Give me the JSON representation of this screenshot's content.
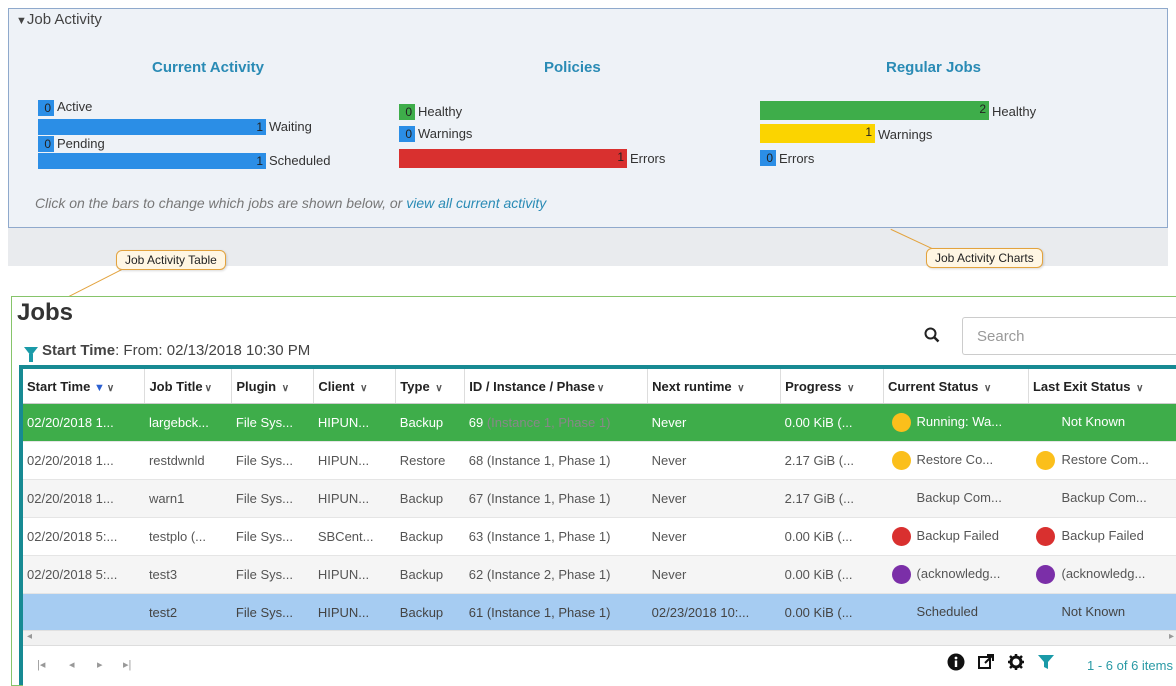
{
  "activity": {
    "header": "Job Activity",
    "sections": {
      "current": {
        "title": "Current Activity",
        "bars": [
          {
            "value": "0",
            "label": "Active"
          },
          {
            "value": "1",
            "label": "Waiting"
          },
          {
            "value": "0",
            "label": "Pending"
          },
          {
            "value": "1",
            "label": "Scheduled"
          }
        ]
      },
      "policies": {
        "title": "Policies",
        "bars": [
          {
            "value": "0",
            "label": "Healthy"
          },
          {
            "value": "0",
            "label": "Warnings"
          },
          {
            "value": "1",
            "label": "Errors"
          }
        ]
      },
      "regular": {
        "title": "Regular Jobs",
        "bars": [
          {
            "value": "2",
            "label": "Healthy"
          },
          {
            "value": "1",
            "label": "Warnings"
          },
          {
            "value": "0",
            "label": "Errors"
          }
        ]
      }
    },
    "hint_prefix": "Click on the bars to change which jobs are shown below, or ",
    "hint_link": "view all current activity"
  },
  "callouts": {
    "table": "Job Activity Table",
    "charts": "Job Activity Charts"
  },
  "jobs": {
    "title": "Jobs",
    "filter_label": "Start Time",
    "filter_value": ": From: 02/13/2018 10:30 PM",
    "search_placeholder": "Search",
    "columns": [
      "Start Time",
      "Job Title",
      "Plugin",
      "Client",
      "Type",
      "ID / Instance / Phase",
      "Next runtime",
      "Progress",
      "Current Status",
      "Last Exit Status"
    ],
    "rows": [
      {
        "start": "02/20/2018 1...",
        "title": "largebck...",
        "plugin": "File Sys...",
        "client": "HIPUN...",
        "type": "Backup",
        "id": "69",
        "instance": "(Instance 1, Phase 1)",
        "next": "Never",
        "progress": "0.00 KiB (...",
        "current": "Running: Wa...",
        "current_color": "#fbbf1b",
        "last": "Not Known",
        "last_color": ""
      },
      {
        "start": "02/20/2018 1...",
        "title": "restdwnld",
        "plugin": "File Sys...",
        "client": "HIPUN...",
        "type": "Restore",
        "id": "68",
        "instance": "(Instance 1, Phase 1)",
        "next": "Never",
        "progress": "2.17 GiB (...",
        "current": "Restore Co...",
        "current_color": "#fbbf1b",
        "last": "Restore Com...",
        "last_color": "#fbbf1b"
      },
      {
        "start": "02/20/2018 1...",
        "title": "warn1",
        "plugin": "File Sys...",
        "client": "HIPUN...",
        "type": "Backup",
        "id": "67",
        "instance": "(Instance 1, Phase 1)",
        "next": "Never",
        "progress": "2.17 GiB (...",
        "current": "Backup Com...",
        "current_color": "",
        "last": "Backup Com...",
        "last_color": ""
      },
      {
        "start": "02/20/2018 5:...",
        "title": "testplo (...",
        "plugin": "File Sys...",
        "client": "SBCent...",
        "type": "Backup",
        "id": "63",
        "instance": "(Instance 1, Phase 1)",
        "next": "Never",
        "progress": "0.00 KiB (...",
        "current": "Backup Failed",
        "current_color": "#d9302f",
        "last": "Backup Failed",
        "last_color": "#d9302f"
      },
      {
        "start": "02/20/2018 5:...",
        "title": "test3",
        "plugin": "File Sys...",
        "client": "HIPUN...",
        "type": "Backup",
        "id": "62",
        "instance": "(Instance 2, Phase 1)",
        "next": "Never",
        "progress": "0.00 KiB (...",
        "current": "(acknowledg...",
        "current_color": "#7b2fa8",
        "last": "(acknowledg...",
        "last_color": "#7b2fa8"
      },
      {
        "start": "",
        "title": "test2",
        "plugin": "File Sys...",
        "client": "HIPUN...",
        "type": "Backup",
        "id": "61",
        "instance": "(Instance 1, Phase 1)",
        "next": "02/23/2018 10:...",
        "progress": "0.00 KiB (...",
        "current": "Scheduled",
        "current_color": "",
        "last": "Not Known",
        "last_color": ""
      }
    ],
    "pager_count": "1 - 6 of 6 items",
    "icons": [
      "info-icon",
      "export-icon",
      "settings-icon",
      "filter-icon"
    ]
  }
}
